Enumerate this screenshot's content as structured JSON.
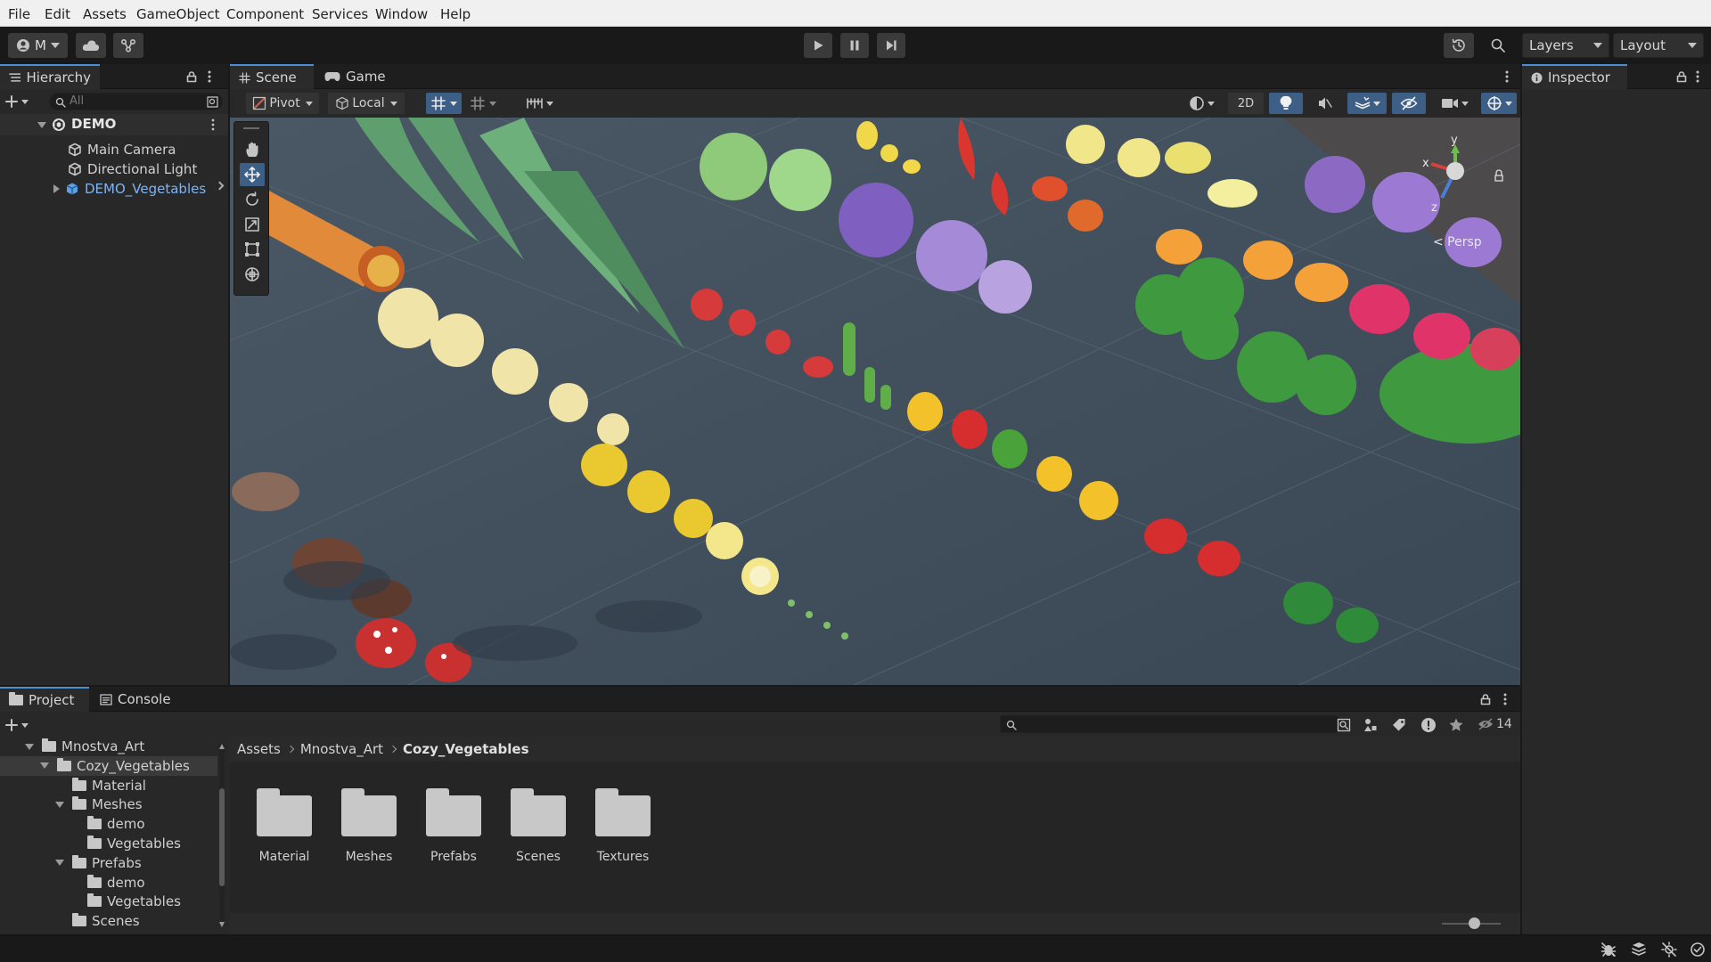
{
  "menu": [
    "File",
    "Edit",
    "Assets",
    "GameObject",
    "Component",
    "Services",
    "Window",
    "Help"
  ],
  "toolbar": {
    "account_label": "M",
    "layers_label": "Layers",
    "layout_label": "Layout"
  },
  "hierarchy": {
    "tab_label": "Hierarchy",
    "search_placeholder": "All",
    "scene_name": "DEMO",
    "items": [
      "Main Camera",
      "Directional Light",
      "DEMO_Vegetables"
    ]
  },
  "scene_view": {
    "tabs": [
      "Scene",
      "Game"
    ],
    "pivot_label": "Pivot",
    "space_label": "Local",
    "mode_2d_label": "2D",
    "persp_label": "< Persp",
    "gizmo_axes": [
      "y",
      "x",
      "z"
    ]
  },
  "inspector": {
    "tab_label": "Inspector"
  },
  "project": {
    "tabs": [
      "Project",
      "Console"
    ],
    "tree": [
      {
        "label": "Mnostva_Art",
        "depth": 0,
        "expanded": true
      },
      {
        "label": "Cozy_Vegetables",
        "depth": 1,
        "expanded": true,
        "selected": true
      },
      {
        "label": "Material",
        "depth": 2,
        "expanded": null
      },
      {
        "label": "Meshes",
        "depth": 2,
        "expanded": true
      },
      {
        "label": "demo",
        "depth": 3,
        "expanded": null
      },
      {
        "label": "Vegetables",
        "depth": 3,
        "expanded": null
      },
      {
        "label": "Prefabs",
        "depth": 2,
        "expanded": true
      },
      {
        "label": "demo",
        "depth": 3,
        "expanded": null
      },
      {
        "label": "Vegetables",
        "depth": 3,
        "expanded": null
      },
      {
        "label": "Scenes",
        "depth": 2,
        "expanded": null
      }
    ],
    "breadcrumb": [
      "Assets",
      "Mnostva_Art",
      "Cozy_Vegetables"
    ],
    "folders": [
      "Material",
      "Meshes",
      "Prefabs",
      "Scenes",
      "Textures"
    ],
    "hidden_count": "14",
    "zoom_slider_value": 0.55
  },
  "colors": {
    "accent_blue": "#4a8ed6",
    "prefab_blue": "#7fb3f0",
    "panel_bg": "#282828",
    "scene_floor": "#3f4f5e"
  }
}
